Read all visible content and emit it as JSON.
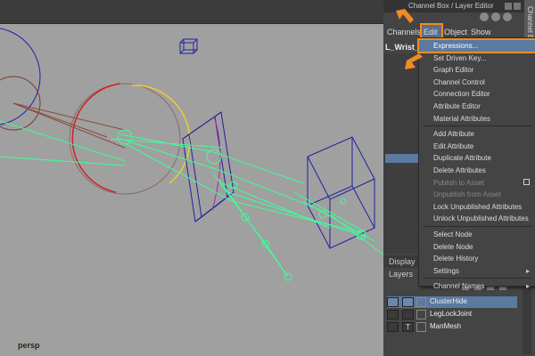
{
  "viewport": {
    "camera_label": "persp"
  },
  "panel": {
    "title": "Channel Box / Layer Editor",
    "side_tab": "Channel Box",
    "menus": {
      "channels": "Channels",
      "edit": "Edit",
      "object": "Object",
      "show": "Show"
    },
    "node_name": "L_Wrist_"
  },
  "edit_menu": {
    "groups": [
      [
        "Expressions...",
        "Set Driven Key...",
        "Graph Editor",
        "Channel Control",
        "Connection Editor",
        "Attribute Editor",
        "Material Attributes"
      ],
      [
        "Add Attribute",
        "Edit Attribute",
        "Duplicate Attribute",
        "Delete Attributes",
        "Publish to Asset",
        "Unpublish from Asset",
        "Lock Unpublished Attributes",
        "Unlock Unpublished Attributes"
      ],
      [
        "Select Node",
        "Delete Node",
        "Delete History",
        "Settings"
      ],
      [
        "Channel Names"
      ]
    ],
    "highlighted": "Expressions...",
    "disabled": [
      "Publish to Asset",
      "Unpublish from Asset"
    ]
  },
  "layer_editor": {
    "tab": "Display",
    "menu": "Layers",
    "layers": [
      {
        "name": "ClusterHide",
        "flag1": "",
        "flag2": "",
        "selected": true
      },
      {
        "name": "LegLockJoint",
        "flag1": "",
        "flag2": "",
        "selected": false
      },
      {
        "name": "ManMesh",
        "flag1": "",
        "flag2": "T",
        "selected": false
      }
    ]
  },
  "colors": {
    "accent": "#f08a24",
    "selection": "#5b7aa0",
    "joint": "#3dff9a",
    "locator": "#2020a0"
  }
}
